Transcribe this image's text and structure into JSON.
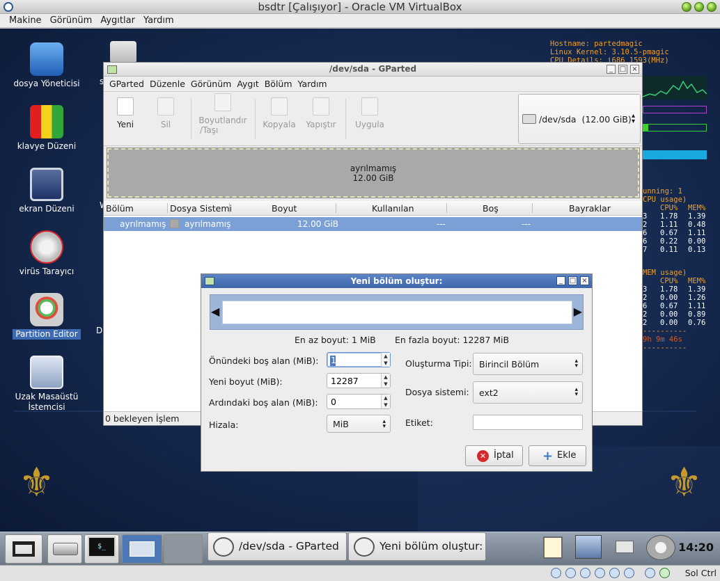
{
  "vbox": {
    "title": "bsdtr [Çalışıyor] - Oracle VM VirtualBox",
    "menu": [
      "Makine",
      "Görünüm",
      "Aygıtlar",
      "Yardım"
    ],
    "host_key": "Sol Ctrl"
  },
  "desktop": {
    "icons": [
      {
        "label": "dosya Yöneticisi"
      },
      {
        "label": "klavye Düzeni"
      },
      {
        "label": "ekran Düzeni"
      },
      {
        "label": "virüs Tarayıcı"
      },
      {
        "label": "Partition Editor",
        "selected": true
      },
      {
        "label": "Uzak Masaüstü İstemcisi"
      }
    ],
    "partial_labels": [
      "s",
      "W",
      "D"
    ]
  },
  "conky": {
    "top_lines": [
      "Hostname: partedmagic",
      "Linux Kernel: 3.10.5-pmagic",
      "CPU Details: i686 1593(MHz)"
    ],
    "processes_running": "unning: 1",
    "cpu_usage_header": "CPU usage)",
    "mem_usage_header": "MEM usage)",
    "col_cpu": "CPU%",
    "col_mem": "MEM%",
    "cpu_rows": [
      [
        "3",
        "1.78",
        "1.39"
      ],
      [
        "2",
        "1.11",
        "0.48"
      ],
      [
        "6",
        "0.67",
        "1.11"
      ],
      [
        "6",
        "0.22",
        "0.00"
      ],
      [
        "7",
        "0.11",
        "0.13"
      ]
    ],
    "mem_rows": [
      [
        "3",
        "1.78",
        "1.39"
      ],
      [
        "2",
        "0.00",
        "1.26"
      ],
      [
        "6",
        "0.67",
        "1.11"
      ],
      [
        "2",
        "0.00",
        "0.89"
      ],
      [
        "2",
        "0.00",
        "0.76"
      ]
    ],
    "uptime": "9h 9m 46s",
    "dashes": "----------"
  },
  "gparted": {
    "title": "/dev/sda - GParted",
    "menu": [
      "GParted",
      "Düzenle",
      "Görünüm",
      "Aygıt",
      "Bölüm",
      "Yardım"
    ],
    "toolbar": {
      "new": "Yeni",
      "delete": "Sil",
      "resize": "Boyutlandır",
      "resize2": "/Taşı",
      "copy": "Kopyala",
      "paste": "Yapıştır",
      "apply": "Uygula"
    },
    "device": "/dev/sda",
    "device_size": "(12.00 GiB)",
    "graph_label": "ayrılmamış",
    "graph_size": "12.00 GiB",
    "columns": [
      "Bölüm",
      "Dosya Sistemi",
      "Boyut",
      "Kullanılan",
      "Boş",
      "Bayraklar"
    ],
    "rows": [
      {
        "partition": "ayrılmamış",
        "filesystem": "ayrılmamış",
        "size": "12.00 GiB",
        "used": "---",
        "free": "---",
        "flags": ""
      }
    ],
    "status": "0 bekleyen İşlem"
  },
  "dialog": {
    "title": "Yeni bölüm oluştur:",
    "min_size": "En az boyut: 1 MiB",
    "max_size": "En fazla boyut: 12287 MiB",
    "free_before_label": "Önündeki boş alan (MiB):",
    "free_before_value": "1",
    "new_size_label": "Yeni boyut (MiB):",
    "new_size_value": "12287",
    "free_after_label": "Ardındaki boş alan (MiB):",
    "free_after_value": "0",
    "align_label": "Hizala:",
    "align_value": "MiB",
    "create_as_label": "Oluşturma Tipi:",
    "create_as_value": "Birincil Bölüm",
    "filesystem_label": "Dosya sistemi:",
    "filesystem_value": "ext2",
    "label_label": "Etiket:",
    "label_value": "",
    "cancel": "İptal",
    "add": "Ekle"
  },
  "taskbar": {
    "tasks": [
      "/dev/sda - GParted",
      "Yeni bölüm oluştur:"
    ],
    "clock": "14:20"
  },
  "colors": {
    "desktop_bg": "#1a3060",
    "selection": "#7aa0d6",
    "dialog_title": "#4a73b6",
    "conky_orange": "#f0a022"
  }
}
